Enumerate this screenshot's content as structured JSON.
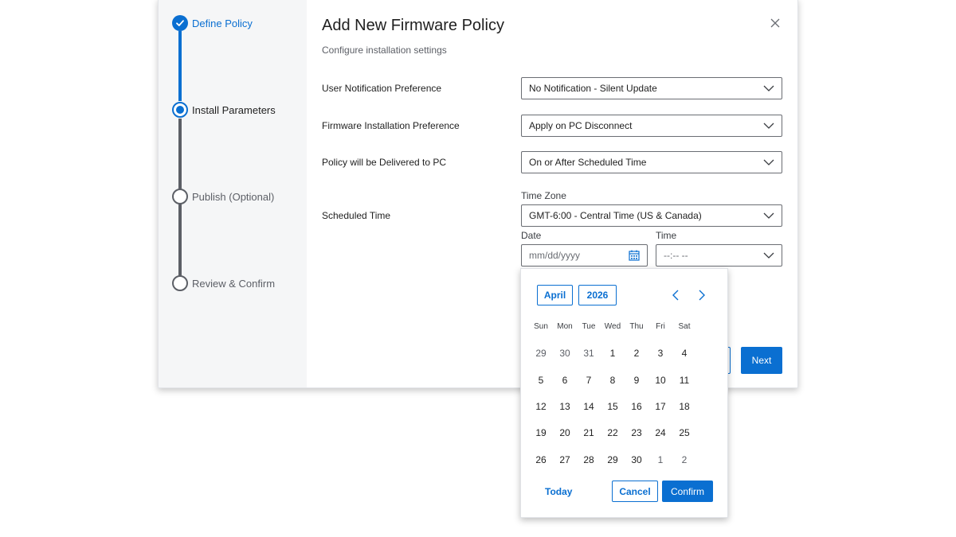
{
  "modal": {
    "title": "Add New Firmware Policy",
    "subtitle": "Configure installation settings",
    "next_label": "Next"
  },
  "steps": [
    {
      "label": "Define Policy",
      "state": "done"
    },
    {
      "label": "Install Parameters",
      "state": "current"
    },
    {
      "label": "Publish (Optional)",
      "state": "todo"
    },
    {
      "label": "Review & Confirm",
      "state": "todo"
    }
  ],
  "form": {
    "notification": {
      "label": "User Notification Preference",
      "value": "No Notification - Silent Update"
    },
    "installation": {
      "label": "Firmware Installation Preference",
      "value": "Apply on PC Disconnect"
    },
    "delivery": {
      "label": "Policy will be Delivered to PC",
      "value": "On or After Scheduled Time"
    },
    "scheduled": {
      "label": "Scheduled Time",
      "timezone_label": "Time Zone",
      "timezone_value": "GMT-6:00 - Central Time (US & Canada)",
      "date_label": "Date",
      "date_placeholder": "mm/dd/yyyy",
      "time_label": "Time",
      "time_placeholder": "--:-- --"
    }
  },
  "calendar": {
    "month": "April",
    "year": "2026",
    "weekdays": [
      "Sun",
      "Mon",
      "Tue",
      "Wed",
      "Thu",
      "Fri",
      "Sat"
    ],
    "weeks": [
      [
        "29",
        "30",
        "31",
        "1",
        "2",
        "3",
        "4"
      ],
      [
        "5",
        "6",
        "7",
        "8",
        "9",
        "10",
        "11"
      ],
      [
        "12",
        "13",
        "14",
        "15",
        "16",
        "17",
        "18"
      ],
      [
        "19",
        "20",
        "21",
        "22",
        "23",
        "24",
        "25"
      ],
      [
        "26",
        "27",
        "28",
        "29",
        "30",
        "1",
        "2"
      ]
    ],
    "today_label": "Today",
    "cancel_label": "Cancel",
    "confirm_label": "Confirm"
  },
  "colors": {
    "accent": "#0a6fd1",
    "sidebar_bg": "#f5f6f7",
    "muted": "#5c5f66"
  }
}
